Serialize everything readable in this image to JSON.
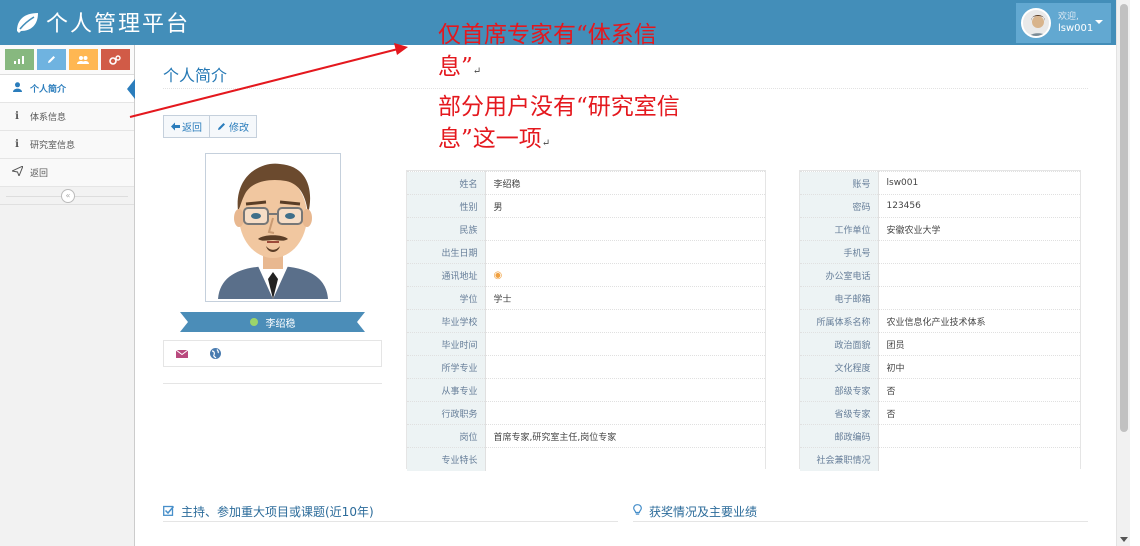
{
  "app": {
    "title": "个人管理平台",
    "user": {
      "welcome": "欢迎,",
      "name": "lsw001"
    }
  },
  "sidebar": {
    "shortcuts": [
      "stats",
      "edit",
      "users",
      "settings"
    ],
    "items": [
      {
        "label": "个人简介",
        "icon": "user-icon",
        "glyph": "▲"
      },
      {
        "label": "体系信息",
        "icon": "info-icon",
        "glyph": "i"
      },
      {
        "label": "研究室信息",
        "icon": "info-icon",
        "glyph": "i"
      },
      {
        "label": "返回",
        "icon": "send-icon",
        "glyph": "✈"
      }
    ],
    "collapse_glyph": "«"
  },
  "page": {
    "title": "个人简介",
    "back_label": "返回",
    "edit_label": "修改",
    "profile_name": "李绍稳"
  },
  "info_left": [
    {
      "label": "姓名",
      "value": "李绍稳"
    },
    {
      "label": "性别",
      "value": "男"
    },
    {
      "label": "民族",
      "value": ""
    },
    {
      "label": "出生日期",
      "value": ""
    },
    {
      "label": "通讯地址",
      "value": "",
      "pin": true
    },
    {
      "label": "学位",
      "value": "学士"
    },
    {
      "label": "毕业学校",
      "value": ""
    },
    {
      "label": "毕业时间",
      "value": ""
    },
    {
      "label": "所学专业",
      "value": ""
    },
    {
      "label": "从事专业",
      "value": ""
    },
    {
      "label": "行政职务",
      "value": ""
    },
    {
      "label": "岗位",
      "value": "首席专家,研究室主任,岗位专家"
    },
    {
      "label": "专业特长",
      "value": ""
    }
  ],
  "info_right": [
    {
      "label": "账号",
      "value": "lsw001"
    },
    {
      "label": "密码",
      "value": "123456"
    },
    {
      "label": "工作单位",
      "value": "安徽农业大学"
    },
    {
      "label": "手机号",
      "value": ""
    },
    {
      "label": "办公室电话",
      "value": ""
    },
    {
      "label": "电子邮箱",
      "value": ""
    },
    {
      "label": "所属体系名称",
      "value": "农业信息化产业技术体系"
    },
    {
      "label": "政治面貌",
      "value": "团员"
    },
    {
      "label": "文化程度",
      "value": "初中"
    },
    {
      "label": "部级专家",
      "value": "否"
    },
    {
      "label": "省级专家",
      "value": "否"
    },
    {
      "label": "邮政编码",
      "value": ""
    },
    {
      "label": "社会兼职情况",
      "value": ""
    }
  ],
  "sections": {
    "projects": "主持、参加重大项目或课题(近10年)",
    "awards": "获奖情况及主要业绩"
  },
  "annotation": {
    "line1": "仅首席专家有“体系信",
    "line2": "息”",
    "line3": "部分用户没有“研究室信",
    "line4": "息”这一项",
    "return_mark": "↵",
    "color": "#e4181e"
  },
  "colors": {
    "topbar": "#438eb9",
    "accent": "#2b7dbc",
    "label_bg": "#edf3f4"
  }
}
